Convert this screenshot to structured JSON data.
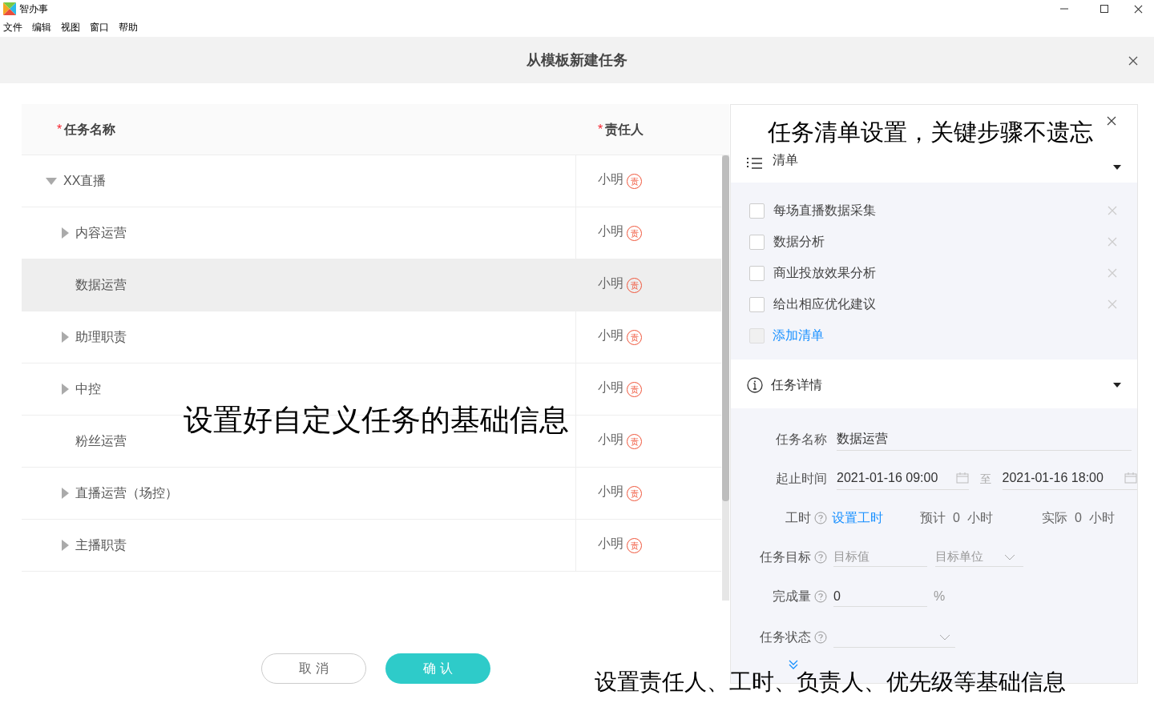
{
  "app": {
    "title": "智办事"
  },
  "menu": [
    "文件",
    "编辑",
    "视图",
    "窗口",
    "帮助"
  ],
  "dialog": {
    "title": "从模板新建任务"
  },
  "table": {
    "columns": [
      {
        "label": "任务名称",
        "mark": "*"
      },
      {
        "label": "责任人",
        "mark": "*"
      }
    ],
    "rows": [
      {
        "name": "XX直播",
        "kind": "folder",
        "expanded": true,
        "selected": false,
        "assignee": "小明",
        "badge": "责",
        "children": [
          {
            "name": "内容运营",
            "kind": "folder",
            "expanded": false,
            "selected": false,
            "assignee": "小明",
            "badge": "责"
          },
          {
            "name": "数据运营",
            "kind": "leaf",
            "selected": true,
            "assignee": "小明",
            "badge": "责"
          },
          {
            "name": "助理职责",
            "kind": "folder",
            "expanded": false,
            "selected": false,
            "assignee": "小明",
            "badge": "责"
          },
          {
            "name": "中控",
            "kind": "folder",
            "expanded": false,
            "selected": false,
            "assignee": "小明",
            "badge": "责"
          },
          {
            "name": "粉丝运营",
            "kind": "leaf",
            "selected": false,
            "assignee": "小明",
            "badge": "责"
          },
          {
            "name": "直播运营（场控）",
            "kind": "folder",
            "expanded": false,
            "selected": false,
            "assignee": "小明",
            "badge": "责"
          },
          {
            "name": "主播职责",
            "kind": "folder",
            "expanded": false,
            "selected": false,
            "assignee": "小明",
            "badge": "责"
          }
        ]
      }
    ]
  },
  "buttons": {
    "cancel": "取 消",
    "confirm": "确 认"
  },
  "checklist": {
    "title": "清单",
    "expanded": true,
    "items": [
      {
        "text": "每场直播数据采集",
        "checked": false
      },
      {
        "text": "数据分析",
        "checked": false
      },
      {
        "text": "商业投放效果分析",
        "checked": false
      },
      {
        "text": "给出相应优化建议",
        "checked": false
      }
    ],
    "add_label": "添加清单"
  },
  "details": {
    "title": "任务详情",
    "expanded": true,
    "name_label": "任务名称",
    "name_value": "数据运营",
    "time_label": "起止时间",
    "start": "2021-01-16 09:00",
    "to": "至",
    "end": "2021-01-16 18:00",
    "hours_label": "工时",
    "hours_link": "设置工时",
    "estimated": "预计  0  小时",
    "actual": "实际  0  小时",
    "goal_label": "任务目标",
    "goal_placeholder": "目标值",
    "unit_placeholder": "目标单位",
    "progress_label": "完成量",
    "progress_value": "0",
    "percent": "%",
    "status_label": "任务状态"
  },
  "captions": [
    "设置好自定义任务的基础信息",
    "任务清单设置，关键步骤不遗忘",
    "设置责任人、工时、负责人、优先级等基础信息"
  ]
}
